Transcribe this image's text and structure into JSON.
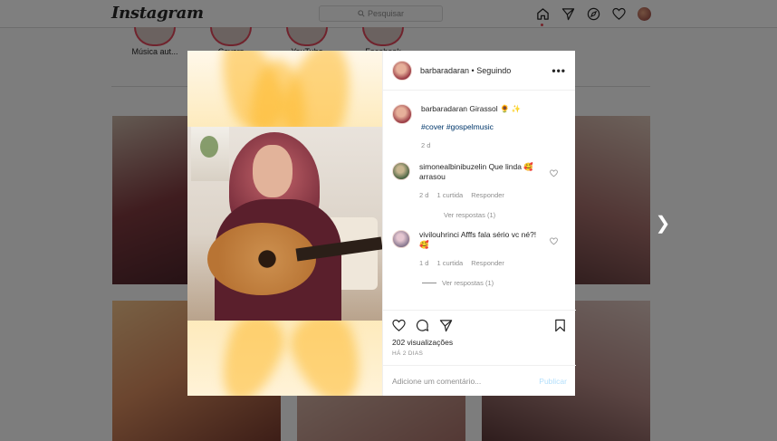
{
  "nav": {
    "logo": "Instagram",
    "search_placeholder": "Pesquisar",
    "icons": [
      "home-icon",
      "direct-icon",
      "explore-icon",
      "activity-heart-icon",
      "profile-avatar"
    ]
  },
  "highlights": [
    {
      "label": "Música aut..."
    },
    {
      "label": "Covers"
    },
    {
      "label": "YouTube"
    },
    {
      "label": "Facebook"
    }
  ],
  "post": {
    "header": {
      "username": "barbaradaran",
      "separator": " • ",
      "follow_status": "Seguindo",
      "more": "•••"
    },
    "caption": {
      "username": "barbaradaran",
      "text": "Girassol 🌻 ✨",
      "tags": "#cover #gospelmusic",
      "time": "2 d"
    },
    "comments": [
      {
        "username": "simonealbinibuzelin",
        "text": "Que linda 🥰 arrasou",
        "time": "2 d",
        "likes": "1 curtida",
        "reply": "Responder",
        "view_replies": "Ver respostas (1)"
      },
      {
        "username": "vivilouhrinci",
        "text": "Afffs fala sério vc né?! 🥰",
        "time": "1 d",
        "likes": "1 curtida",
        "reply": "Responder",
        "view_replies": "Ver respostas (1)"
      }
    ],
    "views": "202 visualizações",
    "ago": "HÁ 2 DIAS",
    "add_comment_placeholder": "Adicione um comentário...",
    "post_button": "Publicar"
  },
  "colors": {
    "link": "#00376b",
    "muted": "#8e8e8e",
    "publish_disabled": "#b2dffc",
    "notification": "#ed4956"
  }
}
